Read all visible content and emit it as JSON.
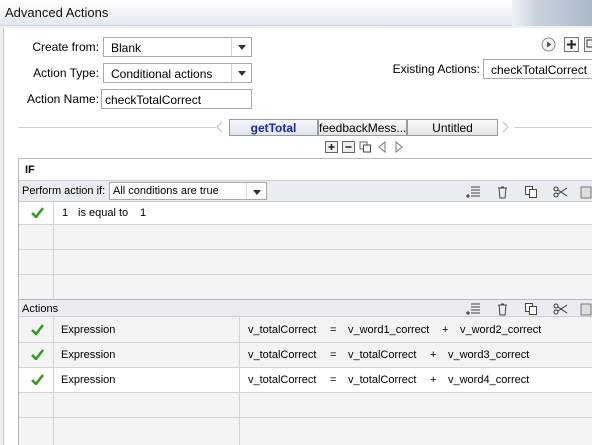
{
  "window": {
    "title": "Advanced Actions"
  },
  "form": {
    "create_from_label": "Create from:",
    "create_from_value": "Blank",
    "action_type_label": "Action Type:",
    "action_type_value": "Conditional actions",
    "action_name_label": "Action Name:",
    "action_name_value": "checkTotalCorrect",
    "existing_actions_label": "Existing Actions:",
    "existing_actions_value": "checkTotalCorrect"
  },
  "tabs": [
    {
      "label": "getTotal",
      "active": true
    },
    {
      "label": "feedbackMess...",
      "active": false
    },
    {
      "label": "Untitled",
      "active": false
    }
  ],
  "if_section": {
    "header": "IF",
    "perform_label": "Perform action if:",
    "perform_value": "All conditions are true",
    "conditions": [
      {
        "checked": true,
        "left": "1",
        "op": "is equal to",
        "right": "1"
      }
    ]
  },
  "actions_section": {
    "header": "Actions",
    "rows": [
      {
        "checked": true,
        "type": "Expression",
        "target": "v_totalCorrect",
        "eq": "=",
        "a": "v_word1_correct",
        "plus": "+",
        "b": "v_word2_correct"
      },
      {
        "checked": true,
        "type": "Expression",
        "target": "v_totalCorrect",
        "eq": "=",
        "a": "v_totalCorrect",
        "plus": "+",
        "b": "v_word3_correct"
      },
      {
        "checked": true,
        "type": "Expression",
        "target": "v_totalCorrect",
        "eq": "=",
        "a": "v_totalCorrect",
        "plus": "+",
        "b": "v_word4_correct"
      }
    ]
  },
  "colors": {
    "accent": "#1a2aa0",
    "check": "#2f9a1e",
    "header_bg": "#e9edf1",
    "selected_row": "#f3f3f3"
  }
}
